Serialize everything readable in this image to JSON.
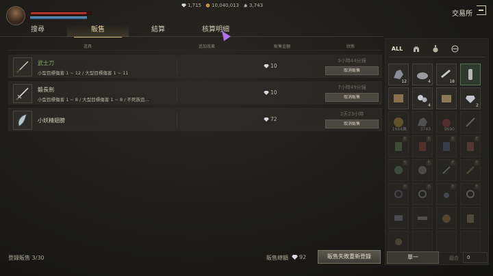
{
  "header": {
    "health_pct": 92,
    "focus_pct": 96,
    "currencies": [
      {
        "icon": "gem-icon",
        "value": "1,715"
      },
      {
        "icon": "gold-coin-icon",
        "value": "10,040,013"
      },
      {
        "icon": "silver-ore-icon",
        "value": "3,743"
      }
    ],
    "title": "交易所"
  },
  "tabs": [
    {
      "label": "搜尋"
    },
    {
      "label": "販售"
    },
    {
      "label": "結算"
    },
    {
      "label": "核算明細"
    }
  ],
  "table": {
    "columns": [
      "道具",
      "追加效果",
      "販售金額",
      "狀態"
    ],
    "rows": [
      {
        "icon": "katana-icon",
        "name": "武士刀",
        "desc": "小型目標傷害 1 ~ 12 / 大型目標傷害 1 ~ 11",
        "price": "10",
        "time": "5小時44分鐘",
        "action": "取消販售"
      },
      {
        "icon": "longsword-icon",
        "name": "鍛長劍",
        "desc": "小型目標傷害 1 ~ 8 / 大型目標傷害 1 ~ 8 / 不死族追...",
        "price": "10",
        "time": "7小時49分鐘",
        "action": "取消販售"
      },
      {
        "icon": "wing-icon",
        "name": "小妖精翅膀",
        "desc": "",
        "price": "72",
        "time": "2天23小時",
        "action": "取消販售"
      }
    ]
  },
  "footer": {
    "registered_label": "登錄販售",
    "registered_count": "3/30",
    "total_label": "販售總額",
    "total_value": "92",
    "relist_label": "販售失敗重新登錄"
  },
  "inventory": {
    "categories": [
      {
        "label": "ALL",
        "icon": "all-icon"
      },
      {
        "label": "",
        "icon": "helmet-icon"
      },
      {
        "label": "",
        "icon": "potion-icon"
      },
      {
        "label": "",
        "icon": "scroll-icon"
      }
    ],
    "slot_texts": [
      "12",
      "4",
      "18",
      "4",
      "2",
      "1664萬",
      "3743",
      "9690"
    ],
    "single_label": "單一",
    "combo_label": "組合",
    "combo_value": "0"
  },
  "colors": {
    "accent": "#cbb37a",
    "name_green": "#8fb068"
  }
}
